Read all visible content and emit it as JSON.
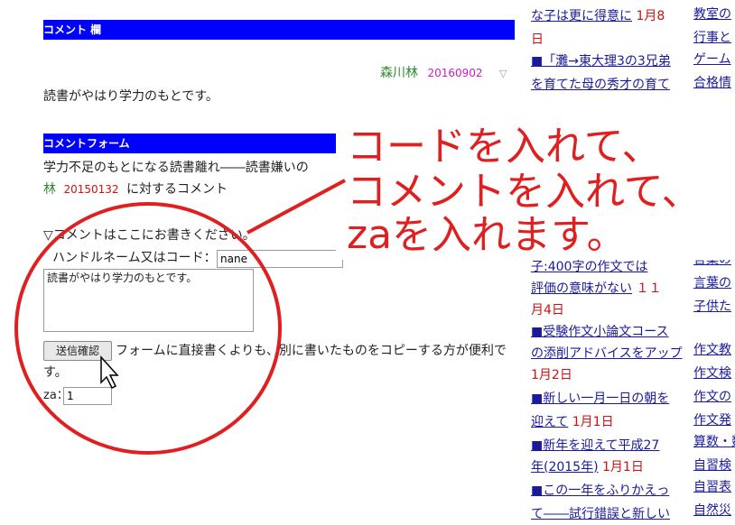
{
  "comment_section": {
    "header": "コメント 欄",
    "author": "森川林",
    "date": "20160902",
    "toggle": "▽",
    "text": "読書がやはり学力のもとです。"
  },
  "comment_form": {
    "header": "コメントフォーム",
    "article_title": "学力不足のもとになる読書離れ――読書嫌いの",
    "author": "林",
    "article_date": "20150132",
    "for_text": "に対するコメント",
    "prompt": "▽コメントはここにお書きください。",
    "handle_label": "ハンドルネーム又はコード：",
    "handle_value": "nane",
    "comment_value": "読書がやはり学力のもとです。",
    "submit_label": "送信確認",
    "note_line1": "フォームに直接書くよりも、別に書いたものをコピーする方が便利で",
    "note_line2": "す。",
    "za_label": "za：",
    "za_value": "1"
  },
  "callout": {
    "line1": "コードを入れて、",
    "line2": "コメントを入れて、",
    "line3": "zaを入れます。"
  },
  "middle_column": [
    {
      "text": "な子は更に得意に",
      "date": "1月8"
    },
    {
      "text": "",
      "date": "日"
    },
    {
      "text": "■「灘→東大理3の3兄弟",
      "date": ""
    },
    {
      "text": "を育てた母の秀才の育て",
      "date": ""
    },
    {
      "text": "子:400字の作文では",
      "date": ""
    },
    {
      "text": "評価の意味がない",
      "date": "１１"
    },
    {
      "text": "",
      "date": "月4日"
    },
    {
      "text": "■受験作文小論文コース",
      "date": ""
    },
    {
      "text": "の添削アドバイスをアップ",
      "date": ""
    },
    {
      "text": "",
      "date": "1月2日"
    },
    {
      "text": "■新しい一月一日の朝を",
      "date": ""
    },
    {
      "text": "迎えて",
      "date": "1月1日"
    },
    {
      "text": "■新年を迎えて平成27",
      "date": ""
    },
    {
      "text": "年(2015年)",
      "date": "1月1日"
    },
    {
      "text": "■この一年をふりかえっ",
      "date": ""
    },
    {
      "text": "て――試行錯誤と新しい",
      "date": ""
    }
  ],
  "right_column": [
    "教室の",
    "行事と",
    "ゲーム",
    "合格情",
    "言葉の",
    "言葉の",
    "子供た",
    "作文教",
    "作文検",
    "作文の",
    "作文発",
    "算数・数",
    "自習検",
    "自習表",
    "自然災"
  ],
  "colors": {
    "header_bar": "#0000ff",
    "callout": "#e02020",
    "link": "#1a1a9c",
    "date": "#d01010"
  }
}
